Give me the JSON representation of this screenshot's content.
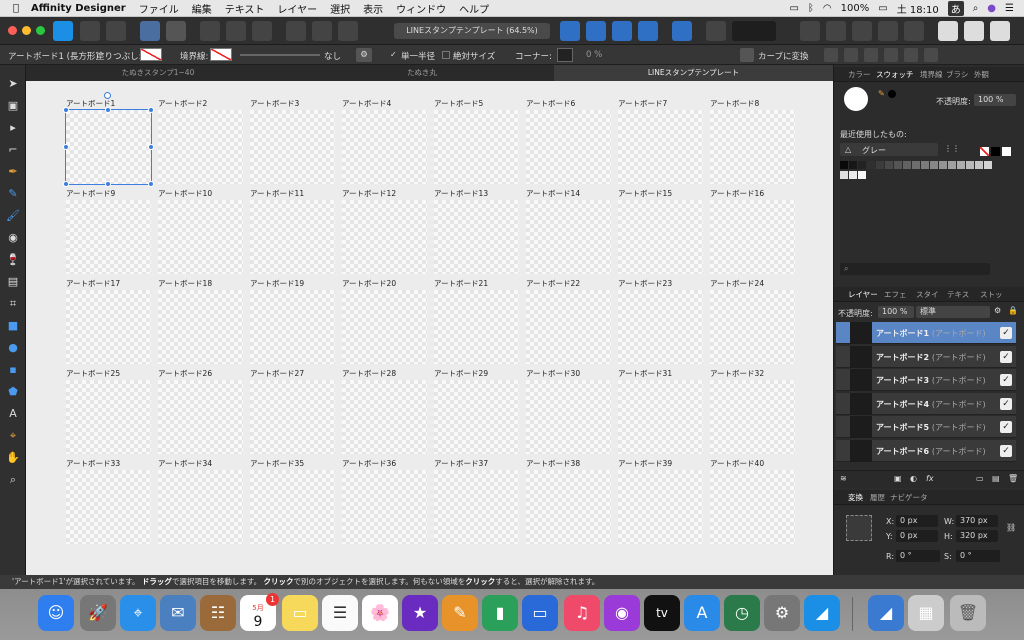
{
  "menubar": {
    "app": "Affinity Designer",
    "items": [
      "ファイル",
      "編集",
      "テキスト",
      "レイヤー",
      "選択",
      "表示",
      "ウィンドウ",
      "ヘルプ"
    ],
    "battery": "100%",
    "datetime": "土 18:10",
    "ime": "あ"
  },
  "toolbar": {
    "doc_title": "LINEスタンプテンプレート (64.5%)"
  },
  "context": {
    "selection": "アートボード1 (長方形)",
    "fill_label": "塗りつぶし:",
    "stroke_label": "境界線:",
    "stroke_none": "なし",
    "single_radius": "単一半径",
    "absolute_size": "絶対サイズ",
    "corner_label": "コーナー:",
    "corner_value": "0 %",
    "convert_curves": "カーブに変換"
  },
  "tabs": [
    "たぬきスタンプ1~40",
    "たぬき丸",
    "LINEスタンプテンプレート"
  ],
  "artboards": [
    "アートボード1",
    "アートボード2",
    "アートボード3",
    "アートボード4",
    "アートボード5",
    "アートボード6",
    "アートボード7",
    "アートボード8",
    "アートボード9",
    "アートボード10",
    "アートボード11",
    "アートボード12",
    "アートボード13",
    "アートボード14",
    "アートボード15",
    "アートボード16",
    "アートボード17",
    "アートボード18",
    "アートボード19",
    "アートボード20",
    "アートボード21",
    "アートボード22",
    "アートボード23",
    "アートボード24",
    "アートボード25",
    "アートボード26",
    "アートボード27",
    "アートボード28",
    "アートボード29",
    "アートボード30",
    "アートボード31",
    "アートボード32",
    "アートボード33",
    "アートボード34",
    "アートボード35",
    "アートボード36",
    "アートボード37",
    "アートボード38",
    "アートボード39",
    "アートボード40"
  ],
  "swatch_panel": {
    "tabs": [
      "カラー",
      "スウォッチ",
      "境界線",
      "ブラシ",
      "外観"
    ],
    "opacity_label": "不透明度:",
    "opacity_value": "100 %",
    "recent_label": "最近使用したもの:",
    "palette": "グレー"
  },
  "layers_panel": {
    "tabs": [
      "レイヤー",
      "エフェ",
      "スタイ",
      "テキス",
      "ストッ"
    ],
    "opacity_label": "不透明度:",
    "opacity_value": "100 %",
    "blend": "標準",
    "items": [
      {
        "name": "アートボード1",
        "kind": "(アートボード)"
      },
      {
        "name": "アートボード2",
        "kind": "(アートボード)"
      },
      {
        "name": "アートボード3",
        "kind": "(アートボード)"
      },
      {
        "name": "アートボード4",
        "kind": "(アートボード)"
      },
      {
        "name": "アートボード5",
        "kind": "(アートボード)"
      },
      {
        "name": "アートボード6",
        "kind": "(アートボード)"
      }
    ]
  },
  "transform_panel": {
    "tabs": [
      "変換",
      "履歴",
      "ナビゲータ"
    ],
    "x": "0 px",
    "y": "0 px",
    "w": "370 px",
    "h": "320 px",
    "r": "0 °",
    "s": "0 °"
  },
  "status": {
    "pre": "'アートボード1'が選択されています。",
    "drag": "ドラッグ",
    "drag_t": "で選択項目を移動します。",
    "click": "クリック",
    "click_t": "で別のオブジェクトを選択します。何もない領域を",
    "click2": "クリック",
    "end": "すると、選択が解除されます。"
  },
  "dock": {
    "calendar_month": "5月",
    "calendar_day": "9",
    "calendar_badge": "1",
    "appletv": "tv"
  }
}
